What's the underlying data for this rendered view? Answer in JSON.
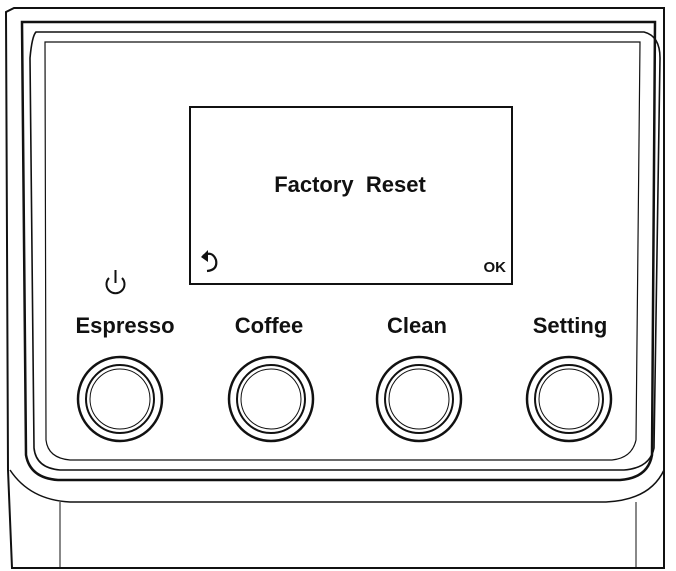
{
  "display": {
    "message": "Factory  Reset",
    "back_icon": "back-arrow-icon",
    "ok_label": "OK"
  },
  "power_icon": "power-icon",
  "buttons": [
    {
      "label": "Espresso"
    },
    {
      "label": "Coffee"
    },
    {
      "label": "Clean"
    },
    {
      "label": "Setting"
    }
  ]
}
